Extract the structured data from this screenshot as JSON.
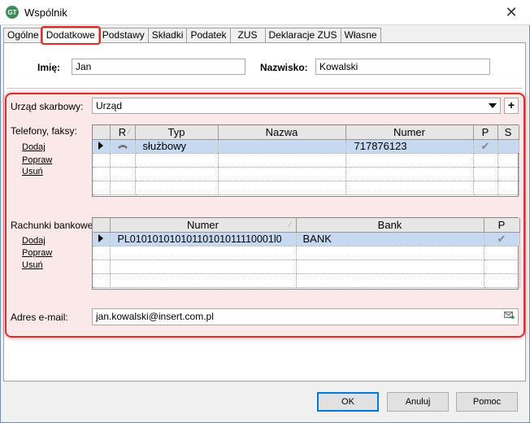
{
  "window": {
    "title": "Wspólnik",
    "close_glyph": "✕",
    "app_icon_text": "GT"
  },
  "tabs": [
    {
      "label": "Ogólne"
    },
    {
      "label": "Dodatkowe",
      "active": true
    },
    {
      "label": "Podstawy"
    },
    {
      "label": "Składki"
    },
    {
      "label": "Podatek"
    },
    {
      "label": "ZUS"
    },
    {
      "label": "Deklaracje ZUS"
    },
    {
      "label": "Własne"
    }
  ],
  "person": {
    "first_name_label": "Imię:",
    "first_name_value": "Jan",
    "last_name_label": "Nazwisko:",
    "last_name_value": "Kowalski"
  },
  "tax_office": {
    "label": "Urząd skarbowy:",
    "value": "Urząd",
    "add_glyph": "+"
  },
  "phones": {
    "label": "Telefony, faksy:",
    "actions": [
      "Dodaj",
      "Popraw",
      "Usuń"
    ],
    "columns": [
      "R",
      "Typ",
      "Nazwa",
      "Numer",
      "P",
      "S"
    ],
    "rows": [
      {
        "r_icon": "phone-icon",
        "typ": "służbowy",
        "nazwa": "",
        "numer": "717876123",
        "p": "✔",
        "s": ""
      }
    ]
  },
  "accounts": {
    "label": "Rachunki bankowe:",
    "actions": [
      "Dodaj",
      "Popraw",
      "Usuń"
    ],
    "columns": [
      "Numer",
      "Bank",
      "P"
    ],
    "rows": [
      {
        "numer": "PL01010101010110101011110001l0",
        "bank": "BANK",
        "p": "✔"
      }
    ]
  },
  "email": {
    "label": "Adres e-mail:",
    "value": "jan.kowalski@insert.com.pl",
    "icon": "email-send-icon"
  },
  "buttons": {
    "ok": "OK",
    "cancel": "Anuluj",
    "help": "Pomoc"
  },
  "colors": {
    "highlight": "#e22b2b",
    "selected_row": "#c7d9f0"
  }
}
